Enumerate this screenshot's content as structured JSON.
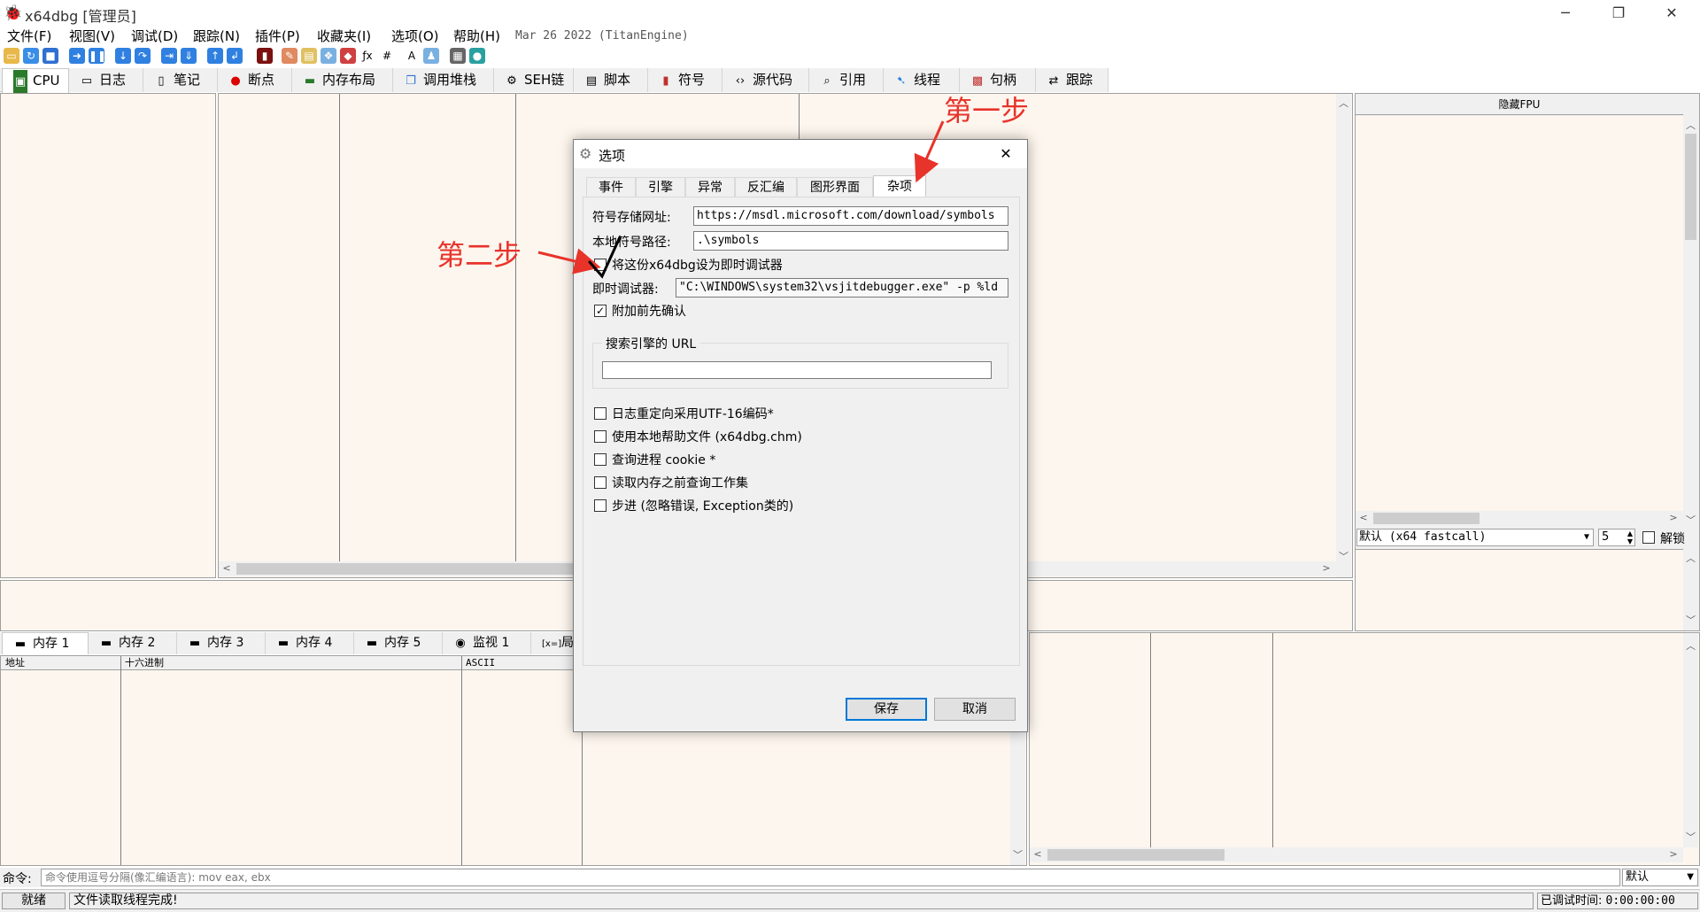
{
  "window": {
    "title": "x64dbg [管理员]",
    "minimize": "─",
    "restore": "❐",
    "close": "✕"
  },
  "menu": {
    "items": [
      "文件(F)",
      "视图(V)",
      "调试(D)",
      "跟踪(N)",
      "插件(P)",
      "收藏夹(I)",
      "选项(O)",
      "帮助(H)"
    ],
    "build_date": "Mar 26 2022 (TitanEngine)"
  },
  "tabs": [
    "CPU",
    "日志",
    "笔记",
    "断点",
    "内存布局",
    "调用堆栈",
    "SEH链",
    "脚本",
    "符号",
    "源代码",
    "引用",
    "线程",
    "句柄",
    "跟踪"
  ],
  "right_panel": {
    "header": "隐藏FPU",
    "calling_convention": "默认 (x64 fastcall)",
    "arg_count": "5",
    "unlock_label": "解锁"
  },
  "memory_tabs": [
    "内存 1",
    "内存 2",
    "内存 3",
    "内存 4",
    "内存 5",
    "监视 1",
    "局"
  ],
  "dump_columns": [
    "地址",
    "十六进制",
    "ASCII"
  ],
  "command": {
    "label": "命令:",
    "placeholder": "命令使用逗号分隔(像汇编语言): mov eax, ebx",
    "mode": "默认"
  },
  "status": {
    "state": "就绪",
    "message": "文件读取线程完成!",
    "debug_time_label": "已调试时间:",
    "debug_time": "0:00:00:00"
  },
  "dialog": {
    "title": "选项",
    "close": "✕",
    "tabs": [
      "事件",
      "引擎",
      "异常",
      "反汇编",
      "图形界面",
      "杂项"
    ],
    "active_tab": "杂项",
    "symbol_store_label": "符号存储网址:",
    "symbol_store_value": "https://msdl.microsoft.com/download/symbols",
    "symbol_path_label": "本地符号路径:",
    "symbol_path_value": ".\\symbols",
    "jit_set_label": "将这份x64dbg设为即时调试器",
    "jit_label": "即时调试器:",
    "jit_value": "\"C:\\WINDOWS\\system32\\vsjitdebugger.exe\" -p %ld",
    "confirm_attach_label": "附加前先确认",
    "search_engine_group": "搜索引擎的 URL",
    "search_engine_value": "",
    "options": [
      "日志重定向采用UTF-16编码*",
      "使用本地帮助文件 (x64dbg.chm)",
      "查询进程 cookie *",
      "读取内存之前查询工作集",
      "步进 (忽略错误, Exception类的)"
    ],
    "save": "保存",
    "cancel": "取消"
  },
  "annotations": {
    "step1": "第一步",
    "step2": "第二步"
  },
  "colors": {
    "annotation": "#e8332a",
    "pane_bg": "#fdf6ee",
    "accent": "#0078d7"
  }
}
